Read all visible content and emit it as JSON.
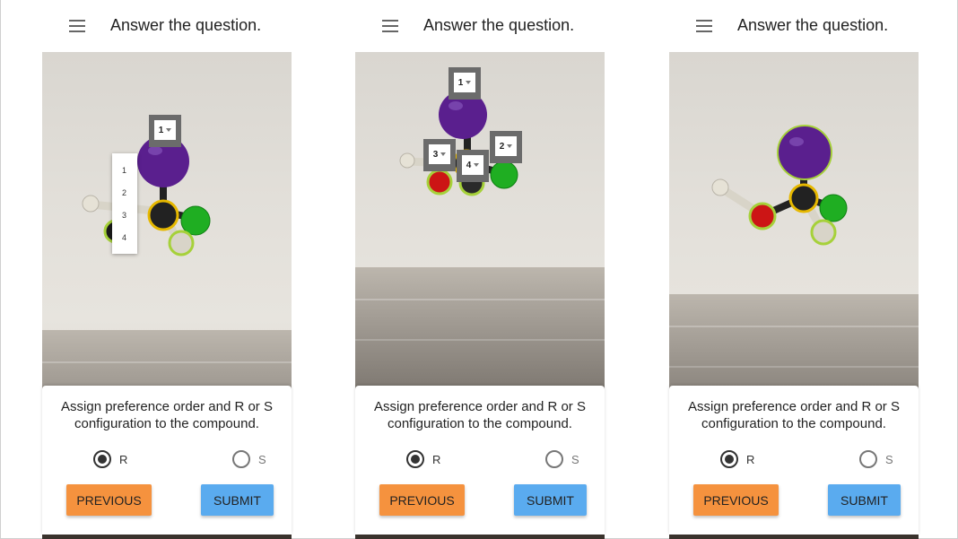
{
  "screens": [
    {
      "title": "Answer the question.",
      "question": "Assign preference order and R or S configuration to the compound.",
      "options": {
        "r": "R",
        "s": "S",
        "selected": "R"
      },
      "buttons": {
        "previous": "PREVIOUS",
        "submit": "SUBMIT"
      },
      "badges": [
        {
          "value": "1"
        }
      ],
      "dropdown_options": [
        "1",
        "2",
        "3",
        "4"
      ]
    },
    {
      "title": "Answer the question.",
      "question": "Assign preference order and R or S configuration to the compound.",
      "options": {
        "r": "R",
        "s": "S",
        "selected": "R"
      },
      "buttons": {
        "previous": "PREVIOUS",
        "submit": "SUBMIT"
      },
      "badges": [
        {
          "value": "1"
        },
        {
          "value": "2"
        },
        {
          "value": "3"
        },
        {
          "value": "4"
        }
      ]
    },
    {
      "title": "Answer the question.",
      "question": "Assign preference order and R or S configuration to the compound.",
      "options": {
        "r": "R",
        "s": "S",
        "selected": "R"
      },
      "buttons": {
        "previous": "PREVIOUS",
        "submit": "SUBMIT"
      }
    }
  ],
  "colors": {
    "iodine": "#5a1f8e",
    "chlorine": "#1fae22",
    "oxygen": "#cc1515",
    "carbon": "#1a1a1a",
    "hydrogen": "#e6e2d6",
    "highlight_yellow": "#e6b800",
    "highlight_green": "#a6d13a",
    "previous_button": "#f5923e",
    "submit_button": "#5aabef"
  }
}
